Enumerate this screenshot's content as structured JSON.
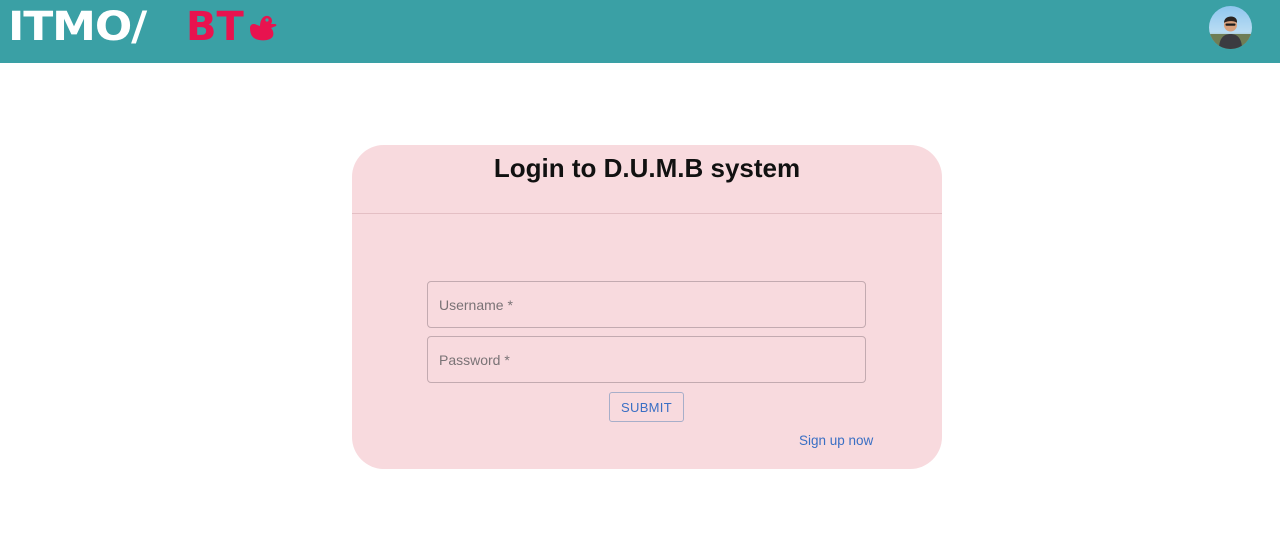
{
  "header": {
    "logo_primary": "ITMO/",
    "logo_accent": "BT",
    "logo_icon": "duck-icon",
    "avatar_icon": "user-avatar",
    "bg_color": "#3aa0a5",
    "accent_color": "#e8134f"
  },
  "login": {
    "title": "Login to D.U.M.B system",
    "username_placeholder": "Username *",
    "password_placeholder": "Password *",
    "submit_label": "SUBMIT",
    "signup_label": "Sign up now",
    "card_color": "#f8dade",
    "link_color": "#3a6fc4"
  }
}
